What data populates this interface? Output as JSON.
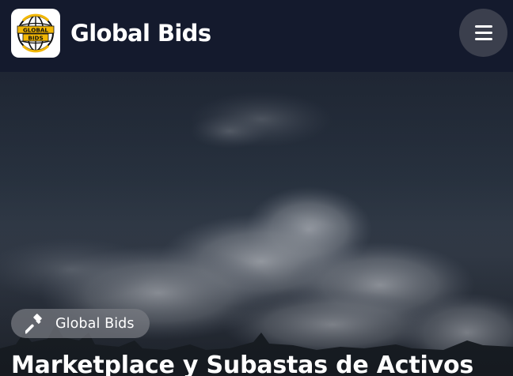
{
  "header": {
    "logo_text": "GLOBAL BIDS",
    "brand_name": "Global Bids",
    "menu_icon": "hamburger-menu-icon"
  },
  "hero": {
    "background": "sky-with-clouds-and-treetops",
    "badge": {
      "icon": "gavel-icon",
      "label": "Global Bids"
    },
    "title": "Marketplace y Subastas de Activos"
  },
  "colors": {
    "header_bg": "#141a2d",
    "logo_accent": "#f2b705",
    "text": "#ffffff",
    "menu_button_bg": "#3b3f4d",
    "badge_bg": "#787c82"
  }
}
